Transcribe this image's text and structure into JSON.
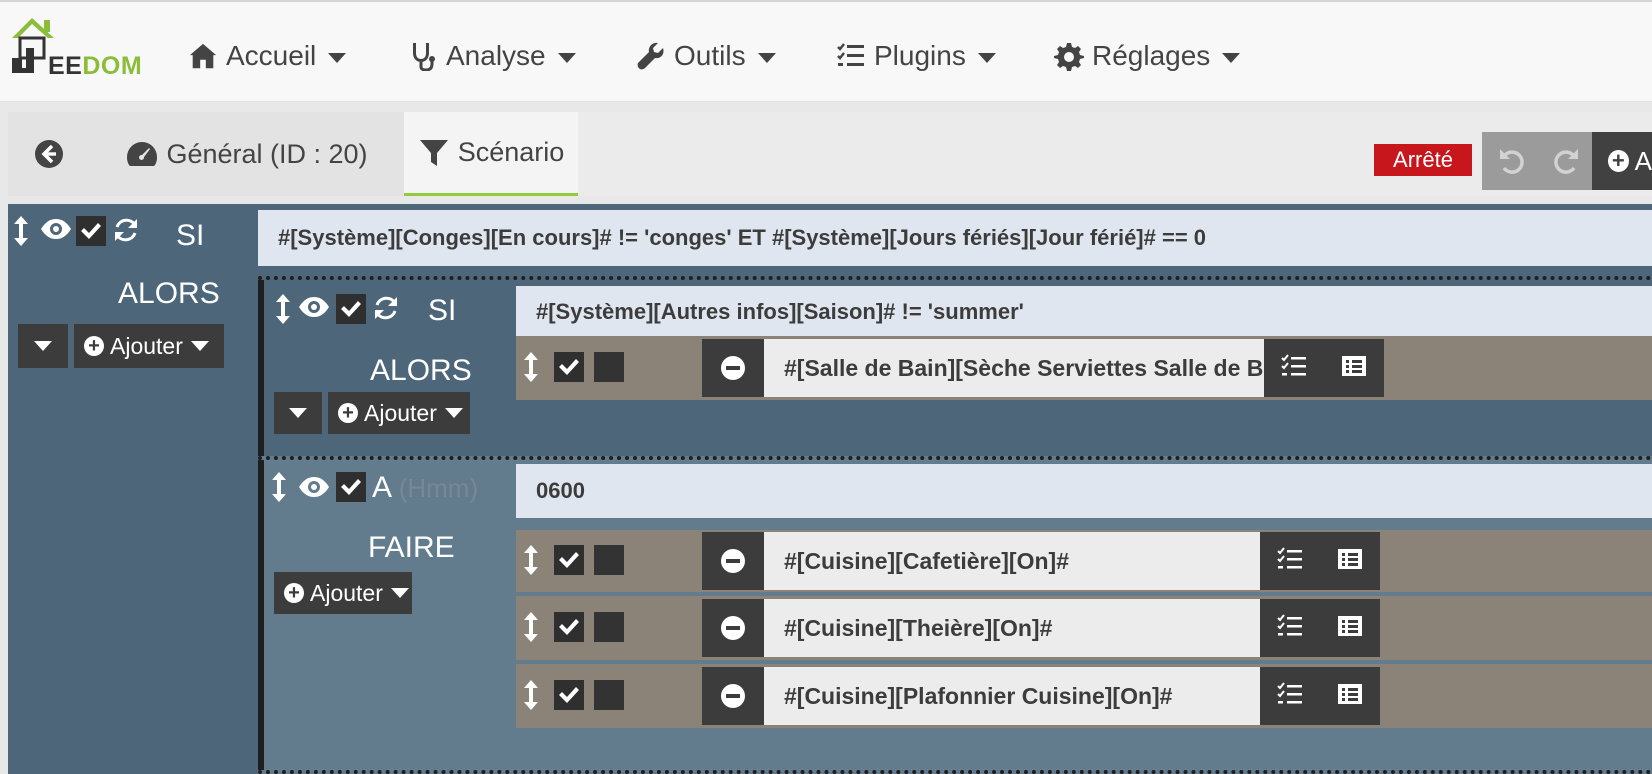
{
  "logo": {
    "text_a": "EE",
    "text_b": "DOM"
  },
  "nav": [
    {
      "label": "Accueil",
      "icon": "home-icon"
    },
    {
      "label": "Analyse",
      "icon": "stethoscope-icon"
    },
    {
      "label": "Outils",
      "icon": "wrench-icon"
    },
    {
      "label": "Plugins",
      "icon": "tasks-icon"
    },
    {
      "label": "Réglages",
      "icon": "gear-icon"
    }
  ],
  "tabs": {
    "general": "Général (ID : 20)",
    "scenario": "Scénario"
  },
  "status": {
    "label": "Arrêté",
    "color": "#c8161d"
  },
  "toolbar": {
    "add_label": "A"
  },
  "block1": {
    "keyword_if": "SI",
    "condition": "#[Système][Conges][En cours]# != 'conges' ET #[Système][Jours fériés][Jour férié]# == 0",
    "keyword_then": "ALORS",
    "add_label": "Ajouter"
  },
  "block2": {
    "keyword_if": "SI",
    "condition": "#[Système][Autres infos][Saison]# != 'summer'",
    "keyword_then": "ALORS",
    "add_label": "Ajouter",
    "actions": [
      "#[Salle de Bain][Sèche Serviettes Salle de Bai"
    ]
  },
  "block3": {
    "keyword_at": "A",
    "hint": "(Hmm)",
    "time": "0600",
    "keyword_do": "FAIRE",
    "add_label": "Ajouter",
    "actions": [
      "#[Cuisine][Cafetière][On]#",
      "#[Cuisine][Theière][On]#",
      "#[Cuisine][Plafonnier Cuisine][On]#"
    ]
  },
  "colors": {
    "accent": "#94ca3d",
    "panel": "#4d6679",
    "action_bg": "#8c8378",
    "condition_bg": "#e0e6ef"
  }
}
